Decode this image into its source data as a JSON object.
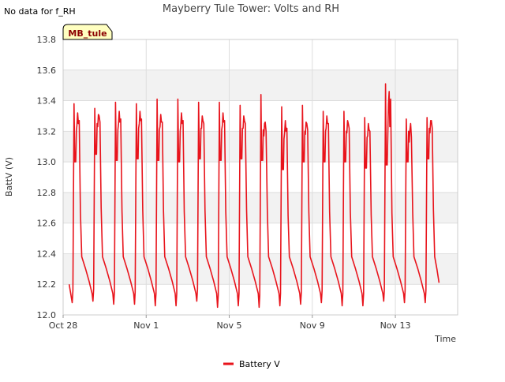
{
  "notice": "No data for f_RH",
  "chart_data": {
    "type": "line",
    "title": "Mayberry Tule Tower: Volts and RH",
    "site_tag": "MB_tule",
    "xlabel": "Time",
    "ylabel": "BattV (V)",
    "xlim": [
      "2023-10-28",
      "2023-11-16"
    ],
    "ylim": [
      12.0,
      13.8
    ],
    "yticks": [
      "12.0",
      "12.2",
      "12.4",
      "12.6",
      "12.8",
      "13.0",
      "13.2",
      "13.4",
      "13.6",
      "13.8"
    ],
    "xticks": [
      {
        "date": "2023-10-28",
        "label": "Oct 28"
      },
      {
        "date": "2023-11-01",
        "label": "Nov 1"
      },
      {
        "date": "2023-11-05",
        "label": "Nov 5"
      },
      {
        "date": "2023-11-09",
        "label": "Nov 9"
      },
      {
        "date": "2023-11-13",
        "label": "Nov 13"
      }
    ],
    "grid": true,
    "legend_position": "bottom-center",
    "series": [
      {
        "name": "Battery V",
        "color": "#e8141c",
        "cycles": [
          {
            "date": "2023-10-28",
            "evening": 12.2,
            "morning_min": 12.08,
            "peak": 13.38,
            "plateau": 13.0,
            "pm_peak": 13.32
          },
          {
            "date": "2023-10-29",
            "evening": 12.45,
            "morning_min": 12.09,
            "peak": 13.35,
            "plateau": 13.05,
            "pm_peak": 13.31
          },
          {
            "date": "2023-10-30",
            "evening": 12.4,
            "morning_min": 12.07,
            "peak": 13.39,
            "plateau": 13.01,
            "pm_peak": 13.33
          },
          {
            "date": "2023-10-31",
            "evening": 12.35,
            "morning_min": 12.07,
            "peak": 13.38,
            "plateau": 13.02,
            "pm_peak": 13.33
          },
          {
            "date": "2023-11-01",
            "evening": 12.4,
            "morning_min": 12.06,
            "peak": 13.41,
            "plateau": 13.01,
            "pm_peak": 13.31
          },
          {
            "date": "2023-11-02",
            "evening": 12.4,
            "morning_min": 12.06,
            "peak": 13.41,
            "plateau": 13.0,
            "pm_peak": 13.32
          },
          {
            "date": "2023-11-03",
            "evening": 12.35,
            "morning_min": 12.09,
            "peak": 13.39,
            "plateau": 13.02,
            "pm_peak": 13.3
          },
          {
            "date": "2023-11-04",
            "evening": 12.4,
            "morning_min": 12.05,
            "peak": 13.39,
            "plateau": 13.01,
            "pm_peak": 13.32
          },
          {
            "date": "2023-11-05",
            "evening": 12.35,
            "morning_min": 12.06,
            "peak": 13.37,
            "plateau": 13.02,
            "pm_peak": 13.3
          },
          {
            "date": "2023-11-06",
            "evening": 12.35,
            "morning_min": 12.05,
            "peak": 13.44,
            "plateau": 13.01,
            "pm_peak": 13.25
          },
          {
            "date": "2023-11-07",
            "evening": 12.35,
            "morning_min": 12.06,
            "peak": 13.36,
            "plateau": 12.95,
            "pm_peak": 13.27
          },
          {
            "date": "2023-11-08",
            "evening": 12.35,
            "morning_min": 12.07,
            "peak": 13.37,
            "plateau": 13.0,
            "pm_peak": 13.26
          },
          {
            "date": "2023-11-09",
            "evening": 12.35,
            "morning_min": 12.08,
            "peak": 13.33,
            "plateau": 13.0,
            "pm_peak": 13.3
          },
          {
            "date": "2023-11-10",
            "evening": 12.35,
            "morning_min": 12.06,
            "peak": 13.33,
            "plateau": 13.0,
            "pm_peak": 13.27
          },
          {
            "date": "2023-11-11",
            "evening": 12.35,
            "morning_min": 12.06,
            "peak": 13.29,
            "plateau": 12.96,
            "pm_peak": 13.25
          },
          {
            "date": "2023-11-12",
            "evening": 12.35,
            "morning_min": 12.09,
            "peak": 13.51,
            "plateau": 12.98,
            "pm_peak": 13.46
          },
          {
            "date": "2023-11-13",
            "evening": 12.35,
            "morning_min": 12.08,
            "peak": 13.28,
            "plateau": 13.0,
            "pm_peak": 13.21
          },
          {
            "date": "2023-11-14",
            "evening": 12.21,
            "morning_min": 12.08,
            "peak": 13.29,
            "plateau": 13.02,
            "pm_peak": 13.27
          }
        ]
      }
    ]
  }
}
